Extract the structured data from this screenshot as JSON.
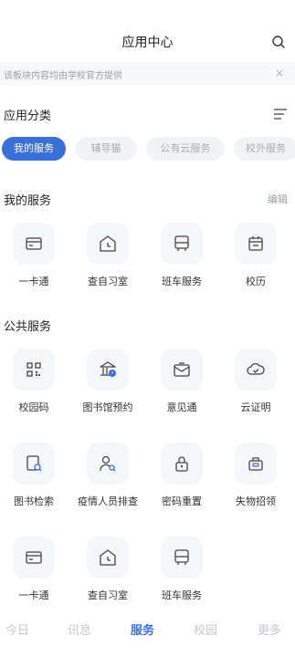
{
  "header": {
    "title": "应用中心",
    "search_icon": "search-icon"
  },
  "notice": {
    "text": "该板块内容均由学校官方提供",
    "close": "×"
  },
  "category": {
    "title": "应用分类",
    "chips": [
      "我的服务",
      "辅导猫",
      "公有云服务",
      "校外服务"
    ],
    "active_index": 0
  },
  "my_services": {
    "title": "我的服务",
    "edit": "编辑",
    "items": [
      {
        "label": "一卡通",
        "icon": "card-icon"
      },
      {
        "label": "查自习室",
        "icon": "clock-icon"
      },
      {
        "label": "班车服务",
        "icon": "bus-icon"
      },
      {
        "label": "校历",
        "icon": "calendar-icon"
      }
    ]
  },
  "public_services": {
    "title": "公共服务",
    "items": [
      {
        "label": "校园码",
        "icon": "qr-code-icon"
      },
      {
        "label": "图书馆预约",
        "icon": "library-icon"
      },
      {
        "label": "意见通",
        "icon": "mail-icon"
      },
      {
        "label": "云证明",
        "icon": "cloud-check-icon"
      },
      {
        "label": "图书检索",
        "icon": "book-search-icon"
      },
      {
        "label": "疫情人员排查",
        "icon": "person-search-icon"
      },
      {
        "label": "密码重置",
        "icon": "lock-icon"
      },
      {
        "label": "失物招领",
        "icon": "lost-found-icon"
      },
      {
        "label": "一卡通",
        "icon": "card-icon"
      },
      {
        "label": "查自习室",
        "icon": "clock-icon"
      },
      {
        "label": "班车服务",
        "icon": "bus-icon"
      }
    ]
  },
  "tabbar": {
    "tabs": [
      "今日",
      "讯息",
      "服务",
      "校园",
      "更多"
    ],
    "active_index": 2
  },
  "colors": {
    "accent": "#3a6fd8",
    "tile_bg": "#f5f6f8",
    "muted": "#a7abb2"
  }
}
